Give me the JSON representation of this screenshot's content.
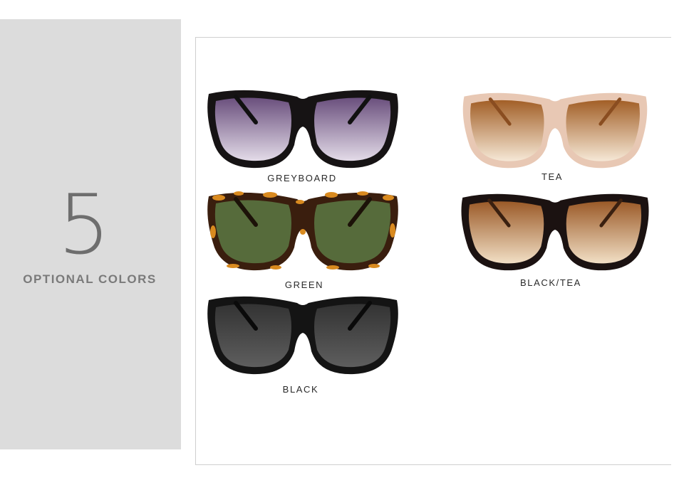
{
  "side": {
    "number": "5",
    "caption": "OPTIONAL COLORS"
  },
  "variants": [
    {
      "label": "GREYBOARD",
      "frame": "#161314",
      "lens_top": "#7a5d8d",
      "lens_bottom": "#d8cfdf",
      "pattern": "solid"
    },
    {
      "label": "TEA",
      "frame": "#e6c6b2",
      "lens_top": "#b06a2c",
      "lens_bottom": "#f3e2cc",
      "pattern": "solid"
    },
    {
      "label": "GREEN",
      "frame": "#3a1e0e",
      "lens_top": "#4d6335",
      "lens_bottom": "#6c7a4a",
      "pattern": "tortoise"
    },
    {
      "label": "BLACK/TEA",
      "frame": "#1b1211",
      "lens_top": "#a4602c",
      "lens_bottom": "#f0dcc2",
      "pattern": "solid"
    },
    {
      "label": "BLACK",
      "frame": "#141414",
      "lens_top": "#3a3a3a",
      "lens_bottom": "#5b5b5b",
      "pattern": "solid"
    }
  ]
}
